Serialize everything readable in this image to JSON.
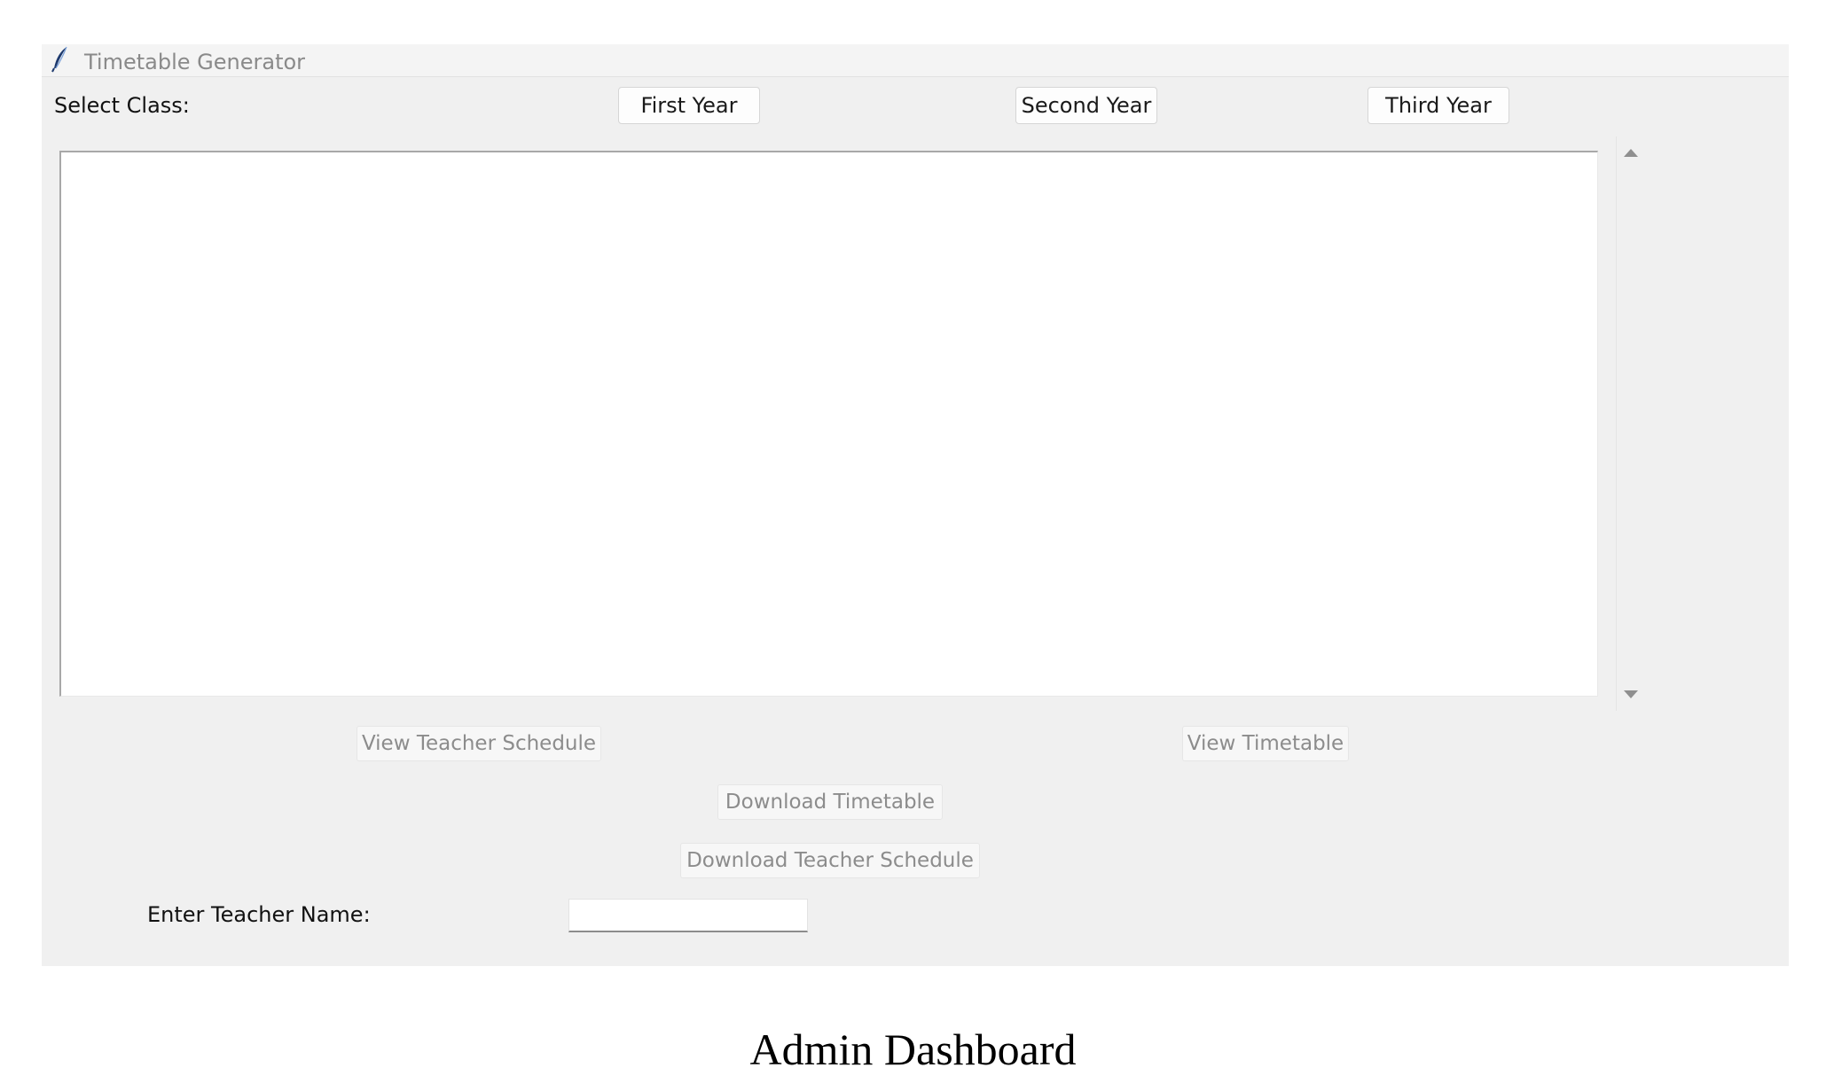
{
  "window": {
    "title": "Timetable Generator",
    "icon": "feather-icon"
  },
  "class_selector": {
    "label": "Select Class:",
    "buttons": [
      "First Year",
      "Second Year",
      "Third Year"
    ]
  },
  "timetable_text": "",
  "actions": {
    "view_teacher_schedule": "View Teacher Schedule",
    "view_timetable": "View Timetable",
    "download_timetable": "Download Timetable",
    "download_teacher_schedule": "Download Teacher Schedule"
  },
  "teacher": {
    "label": "Enter Teacher Name:",
    "value": ""
  },
  "caption": "Admin Dashboard"
}
